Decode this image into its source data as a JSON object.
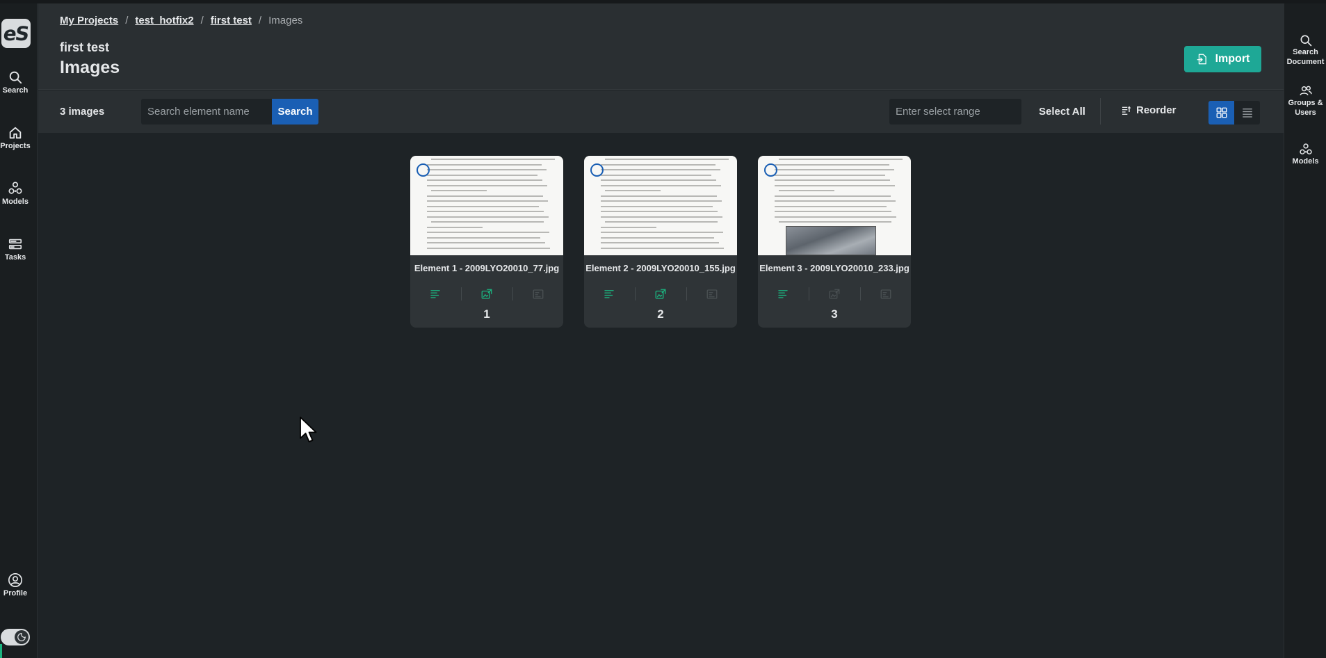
{
  "app": {
    "logo_text": "eS"
  },
  "left_nav": [
    {
      "id": "search",
      "label": "Search",
      "icon": "search-icon"
    },
    {
      "id": "projects",
      "label": "Projects",
      "icon": "home-icon"
    },
    {
      "id": "models",
      "label": "Models",
      "icon": "models-icon"
    },
    {
      "id": "tasks",
      "label": "Tasks",
      "icon": "tasks-icon"
    },
    {
      "id": "profile",
      "label": "Profile",
      "icon": "user-icon"
    }
  ],
  "right_nav": [
    {
      "id": "search-document",
      "label": "Search Document",
      "icon": "search-icon"
    },
    {
      "id": "groups-users",
      "label": "Groups & Users",
      "icon": "users-icon"
    },
    {
      "id": "models",
      "label": "Models",
      "icon": "models-icon"
    }
  ],
  "breadcrumb": {
    "items": [
      "My Projects",
      "test_hotfix2",
      "first test"
    ],
    "current": "Images",
    "separator": "/"
  },
  "header": {
    "subtitle": "first test",
    "title": "Images",
    "import_label": "Import"
  },
  "toolbar": {
    "count_text": "3 images",
    "search_placeholder": "Search element name",
    "search_label": "Search",
    "range_placeholder": "Enter select range",
    "select_all_label": "Select All",
    "reorder_label": "Reorder",
    "view_mode": "grid"
  },
  "elements": [
    {
      "name": "Element 1 - 2009LYO20010_77.jpg",
      "number": "1",
      "has_photo": false,
      "icons_active": [
        true,
        true,
        false
      ]
    },
    {
      "name": "Element 2 - 2009LYO20010_155.jpg",
      "number": "2",
      "has_photo": false,
      "icons_active": [
        true,
        true,
        false
      ]
    },
    {
      "name": "Element 3 - 2009LYO20010_233.jpg",
      "number": "3",
      "has_photo": true,
      "icons_active": [
        true,
        false,
        false
      ]
    }
  ],
  "colors": {
    "accent_blue": "#1a5fb4",
    "import_teal": "#1ea896",
    "icon_green": "#1bb37f",
    "icon_disabled": "#4a5053"
  },
  "theme_toggle": {
    "icon": "moon-icon",
    "state": "dark"
  }
}
